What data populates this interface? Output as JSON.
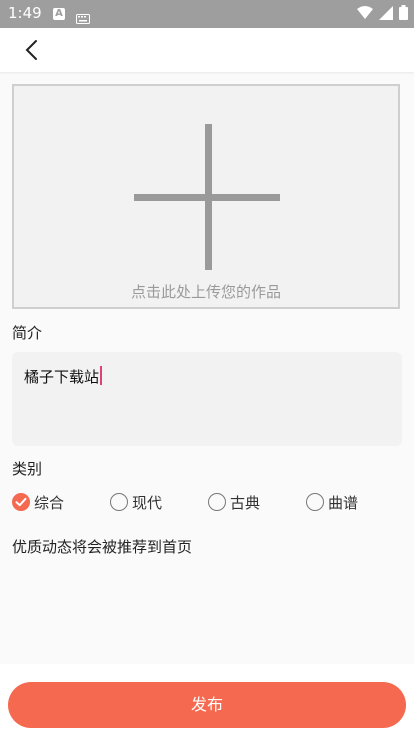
{
  "status_bar": {
    "time": "1:49",
    "a_badge": "A"
  },
  "upload": {
    "hint": "点击此处上传您的作品"
  },
  "intro": {
    "label": "简介",
    "value": "橘子下载站"
  },
  "category": {
    "label": "类别",
    "options": [
      "综合",
      "现代",
      "古典",
      "曲谱"
    ],
    "selected": "综合"
  },
  "note": "优质动态将会被推荐到首页",
  "publish_button": "发布",
  "colors": {
    "accent": "#f4694f",
    "caret": "#e0407a",
    "status_bar": "#9e9e9e"
  }
}
